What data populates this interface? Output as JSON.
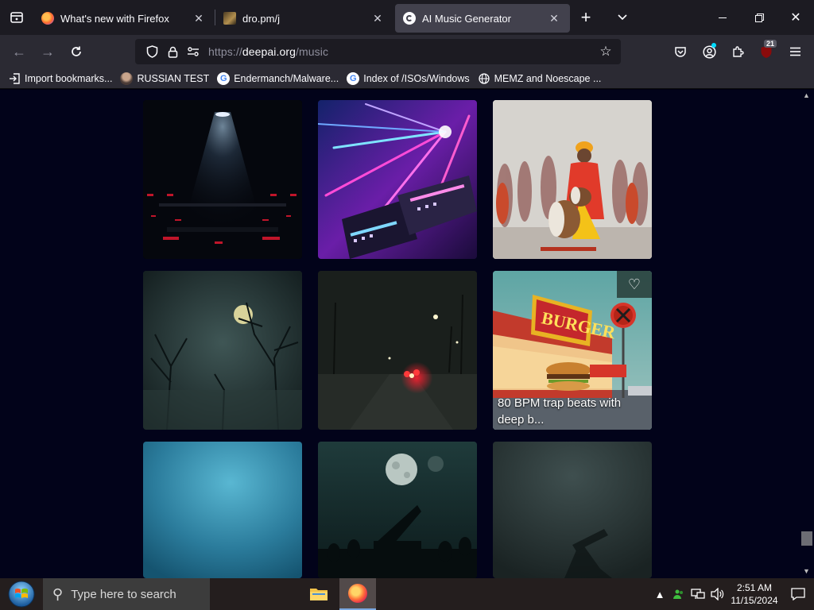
{
  "browser": {
    "tabs": [
      {
        "title": "What's new with Firefox",
        "icon": "firefox-icon",
        "active": false
      },
      {
        "title": "dro.pm/j",
        "icon": "page-thumbnail-icon",
        "active": false
      },
      {
        "title": "AI Music Generator",
        "icon": "deepai-icon",
        "active": true
      }
    ],
    "url": {
      "scheme": "https://",
      "host": "deepai.org",
      "path": "/music"
    },
    "extensions_badge": "21",
    "bookmarks": [
      {
        "label": "Import bookmarks...",
        "icon": "import-icon"
      },
      {
        "label": "RUSSIAN TEST",
        "icon": "avatar-icon"
      },
      {
        "label": "Endermanch/Malware...",
        "icon": "google-icon"
      },
      {
        "label": "Index of /ISOs/Windows",
        "icon": "google-icon"
      },
      {
        "label": "MEMZ and Noescape ...",
        "icon": "globe-icon"
      }
    ]
  },
  "gallery": {
    "tiles": [
      {
        "theme": "dark stage with spotlight",
        "caption": ""
      },
      {
        "theme": "neon synthesizers and lasers",
        "caption": ""
      },
      {
        "theme": "drummer with dhol and dancers",
        "caption": ""
      },
      {
        "theme": "foggy forest with moon",
        "caption": ""
      },
      {
        "theme": "night road with red lights",
        "caption": ""
      },
      {
        "theme": "retro burger diner",
        "caption": "80 BPM trap beats with deep b..."
      },
      {
        "theme": "blue misty gradient",
        "caption": ""
      },
      {
        "theme": "moonlit orchestra",
        "caption": ""
      },
      {
        "theme": "misty dark scene",
        "caption": ""
      }
    ],
    "burger_sign": "BURGER"
  },
  "taskbar": {
    "search_placeholder": "Type here to search",
    "time": "2:51 AM",
    "date": "11/15/2024"
  },
  "colors": {
    "tabstrip": "#1c1b22",
    "toolbar": "#2b2a33",
    "urlbar": "#1c1b22",
    "page_bg": "#02031a",
    "taskbar": "#241e1e"
  }
}
